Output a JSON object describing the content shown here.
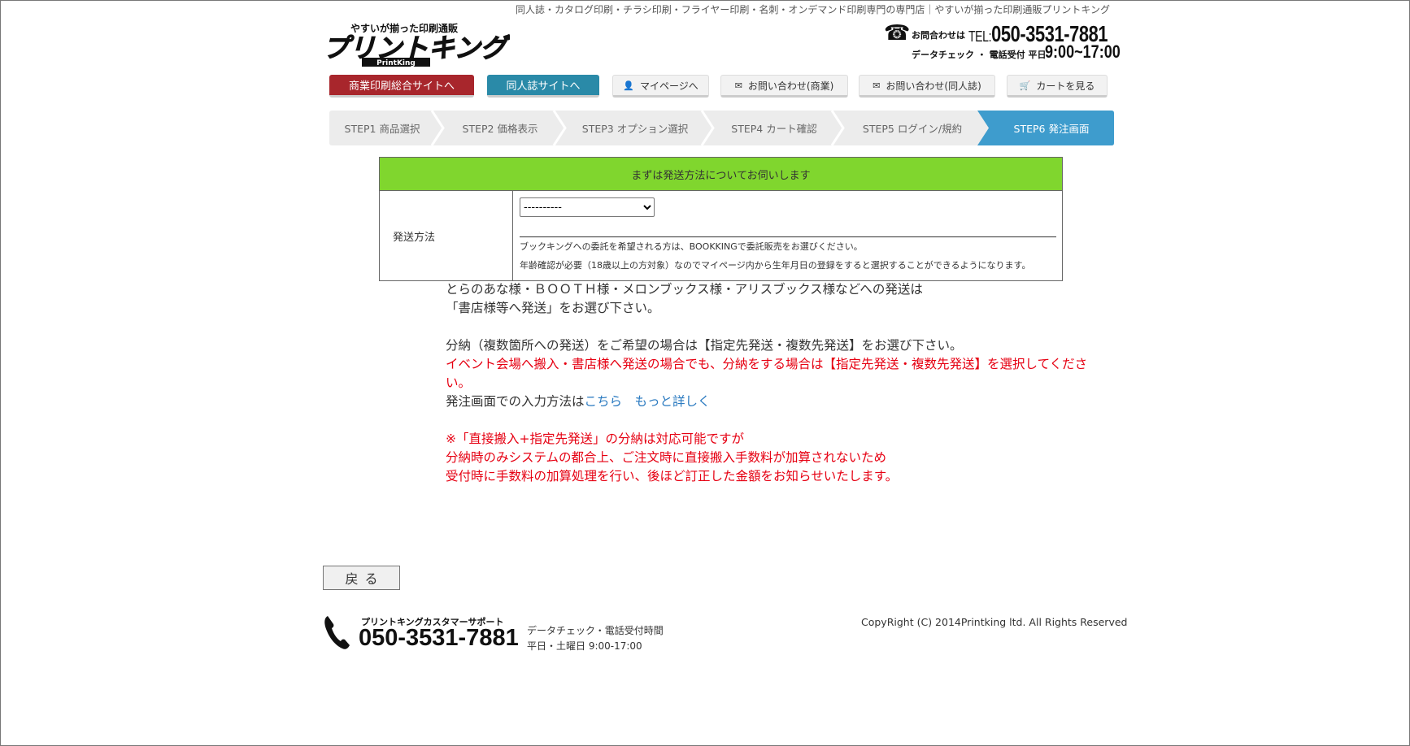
{
  "header": {
    "tagline": "同人誌・カタログ印刷・チラシ印刷・フライヤー印刷・名刺・オンデマンド印刷専門の専門店｜やすいが揃った印刷通販プリントキング",
    "logo_sub": "やすいが揃った印刷通販",
    "logo_main": "プリントキング",
    "logo_en": "PrintKing",
    "contact_label": "お問合わせは",
    "tel_prefix": "TEL:",
    "tel": "050-3531-7881",
    "hours_label": "データチェック ・ 電話受付 平日",
    "hours": "9:00~17:00"
  },
  "nav": {
    "business_site": "商業印刷総合サイトへ",
    "doujin_site": "同人誌サイトへ",
    "mypage": "マイページへ",
    "inquiry_business": "お問い合わせ(商業)",
    "inquiry_doujin": "お問い合わせ(同人誌)",
    "cart": "カートを見る"
  },
  "steps": [
    {
      "label": "STEP1 商品選択",
      "active": false
    },
    {
      "label": "STEP2 価格表示",
      "active": false
    },
    {
      "label": "STEP3 オプション選択",
      "active": false
    },
    {
      "label": "STEP4 カート確認",
      "active": false
    },
    {
      "label": "STEP5 ログイン/規約",
      "active": false
    },
    {
      "label": "STEP6 発注画面",
      "active": true
    }
  ],
  "shipping_panel": {
    "heading": "まずは発送方法についてお伺いします",
    "label": "発送方法",
    "select_value": "----------",
    "note1": "ブックキングへの委託を希望される方は、BOOKKINGで委託販売をお選びください。",
    "note2": "年齢確認が必要（18歳以上の方対象）なのでマイページ内から生年月日の登録をすると選択することができるようになります。"
  },
  "info": {
    "line1": "とらのあな様・ＢＯＯＴＨ様・メロンブックス様・アリスブックス様などへの発送は",
    "line2": "「書店様等へ発送」をお選び下さい。",
    "line3": "分納（複数箇所への発送）をご希望の場合は【指定先発送・複数先発送】をお選び下さい。",
    "line4_red": "イベント会場へ搬入・書店様へ発送の場合でも、分納をする場合は【指定先発送・複数先発送】を選択してください。",
    "line5_prefix": "発注画面での入力方法は",
    "link_here": "こちら",
    "link_more": "もっと詳しく",
    "red1": "※「直接搬入+指定先発送」の分納は対応可能ですが",
    "red2": "分納時のみシステムの都合上、ご注文時に直接搬入手数料が加算されないため",
    "red3": "受付時に手数料の加算処理を行い、後ほど訂正した金額をお知らせいたします。"
  },
  "back_button": "戻る",
  "footer": {
    "support_label": "プリントキングカスタマーサポート",
    "tel": "050-3531-7881",
    "hours_label": "データチェック・電話受付時間",
    "hours": "平日・土曜日 9:00-17:00",
    "copyright": "CopyRight (C) 2014Printking ltd. All Rights Reserved"
  },
  "colors": {
    "business_red": "#a8262c",
    "doujin_teal": "#2a8aa8",
    "step_active": "#3e9ccd",
    "panel_green": "#80d62e",
    "alert_red": "#e60012",
    "link_blue": "#2a7ac0"
  }
}
